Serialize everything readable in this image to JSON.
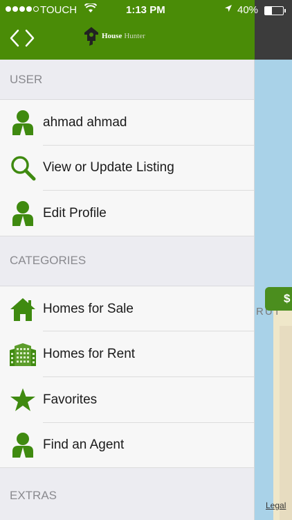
{
  "status_bar": {
    "carrier": "TOUCH",
    "time": "1:13 PM",
    "battery": "40%",
    "battery_level": 0.4
  },
  "header": {
    "logo_house": "House",
    "logo_hunter": "Hunter"
  },
  "map": {
    "city_label": "RUT",
    "price_marker": "$",
    "legal": "Legal"
  },
  "drawer": {
    "sections": [
      {
        "title": "USER",
        "items": [
          {
            "label": "ahmad ahmad",
            "icon": "user-icon"
          },
          {
            "label": "View or Update Listing",
            "icon": "search-icon"
          },
          {
            "label": "Edit Profile",
            "icon": "user-icon"
          }
        ]
      },
      {
        "title": "CATEGORIES",
        "items": [
          {
            "label": "Homes for Sale",
            "icon": "home-icon"
          },
          {
            "label": "Homes for Rent",
            "icon": "building-icon"
          },
          {
            "label": "Favorites",
            "icon": "star-icon"
          },
          {
            "label": "Find an Agent",
            "icon": "user-icon"
          }
        ]
      },
      {
        "title": "EXTRAS",
        "items": []
      }
    ]
  },
  "colors": {
    "brand_green": "#4a8c07",
    "icon_green": "#3f8a10"
  }
}
